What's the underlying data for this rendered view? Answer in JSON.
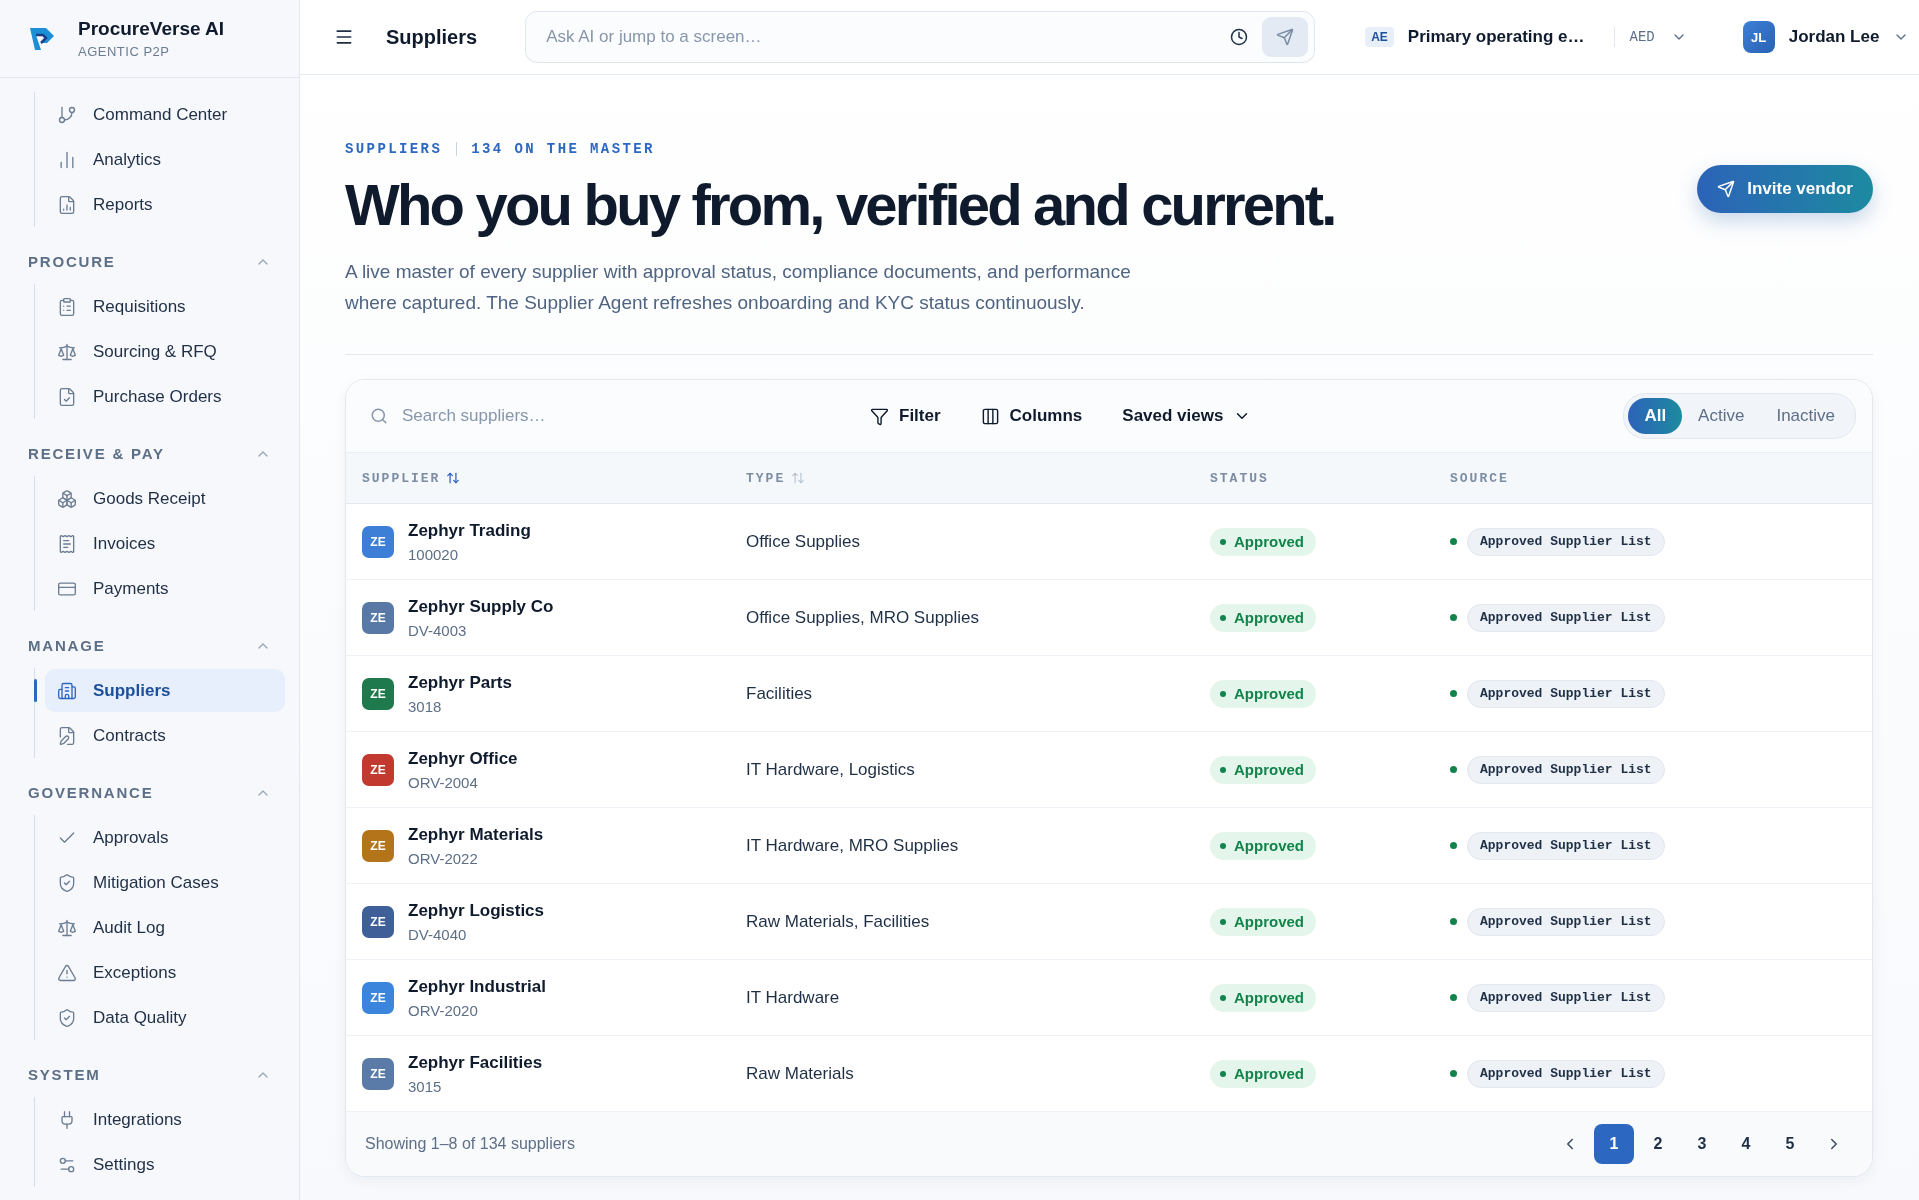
{
  "app": {
    "name": "ProcureVerse AI",
    "tagline": "AGENTIC P2P"
  },
  "sidebar": {
    "top_items": [
      {
        "label": "Command Center",
        "selected": false
      },
      {
        "label": "Analytics",
        "selected": false
      },
      {
        "label": "Reports",
        "selected": false
      }
    ],
    "sections": [
      {
        "title": "PROCURE",
        "expanded": true,
        "items": [
          {
            "label": "Requisitions",
            "selected": false
          },
          {
            "label": "Sourcing & RFQ",
            "selected": false
          },
          {
            "label": "Purchase Orders",
            "selected": false
          }
        ]
      },
      {
        "title": "RECEIVE & PAY",
        "expanded": true,
        "items": [
          {
            "label": "Goods Receipt",
            "selected": false
          },
          {
            "label": "Invoices",
            "selected": false
          },
          {
            "label": "Payments",
            "selected": false
          }
        ]
      },
      {
        "title": "MANAGE",
        "expanded": true,
        "items": [
          {
            "label": "Suppliers",
            "selected": true
          },
          {
            "label": "Contracts",
            "selected": false
          }
        ]
      },
      {
        "title": "GOVERNANCE",
        "expanded": true,
        "items": [
          {
            "label": "Approvals",
            "selected": false
          },
          {
            "label": "Mitigation Cases",
            "selected": false
          },
          {
            "label": "Audit Log",
            "selected": false
          },
          {
            "label": "Exceptions",
            "selected": false
          },
          {
            "label": "Data Quality",
            "selected": false
          }
        ]
      },
      {
        "title": "SYSTEM",
        "expanded": true,
        "items": [
          {
            "label": "Integrations",
            "selected": false
          },
          {
            "label": "Settings",
            "selected": false
          }
        ]
      }
    ]
  },
  "topbar": {
    "page_title": "Suppliers",
    "search": {
      "placeholder": "Ask AI or jump to a screen…"
    },
    "entity": {
      "code": "AE",
      "name": "Primary operating e…",
      "currency": "AED"
    },
    "user": {
      "initials": "JL",
      "name": "Jordan Lee"
    }
  },
  "hero": {
    "eyebrow": "SUPPLIERS",
    "count": "134 ON THE MASTER",
    "title": "Who you buy from, verified and current.",
    "description": "A live master of every supplier with approval status, compliance documents, and performance where captured. The Supplier Agent refreshes onboarding and KYC status continuously.",
    "action": "Invite vendor"
  },
  "table": {
    "search": {
      "placeholder": "Search suppliers…"
    },
    "tools": [
      "Filter",
      "Columns",
      "Saved views"
    ],
    "segments": [
      {
        "label": "All",
        "selected": true
      },
      {
        "label": "Active",
        "selected": false
      },
      {
        "label": "Inactive",
        "selected": false
      }
    ],
    "columns": [
      {
        "label": "SUPPLIER",
        "sorted": true
      },
      {
        "label": "TYPE",
        "sorted": false
      },
      {
        "label": "STATUS"
      },
      {
        "label": "SOURCE"
      }
    ],
    "rows": [
      {
        "initials": "ZE",
        "color": "#3d7fd6",
        "name": "Zephyr Trading",
        "code": "100020",
        "type": "Office Supplies",
        "status": "Approved",
        "source": "Approved Supplier List"
      },
      {
        "initials": "ZE",
        "color": "#5879a6",
        "name": "Zephyr Supply Co",
        "code": "DV-4003",
        "type": "Office Supplies, MRO Supplies",
        "status": "Approved",
        "source": "Approved Supplier List"
      },
      {
        "initials": "ZE",
        "color": "#1e7a4c",
        "name": "Zephyr Parts",
        "code": "3018",
        "type": "Facilities",
        "status": "Approved",
        "source": "Approved Supplier List"
      },
      {
        "initials": "ZE",
        "color": "#c2392f",
        "name": "Zephyr Office",
        "code": "ORV-2004",
        "type": "IT Hardware, Logistics",
        "status": "Approved",
        "source": "Approved Supplier List"
      },
      {
        "initials": "ZE",
        "color": "#b4751a",
        "name": "Zephyr Materials",
        "code": "ORV-2022",
        "type": "IT Hardware, MRO Supplies",
        "status": "Approved",
        "source": "Approved Supplier List"
      },
      {
        "initials": "ZE",
        "color": "#3e5f98",
        "name": "Zephyr Logistics",
        "code": "DV-4040",
        "type": "Raw Materials, Facilities",
        "status": "Approved",
        "source": "Approved Supplier List"
      },
      {
        "initials": "ZE",
        "color": "#3b86dc",
        "name": "Zephyr Industrial",
        "code": "ORV-2020",
        "type": "IT Hardware",
        "status": "Approved",
        "source": "Approved Supplier List"
      },
      {
        "initials": "ZE",
        "color": "#5a7ba8",
        "name": "Zephyr Facilities",
        "code": "3015",
        "type": "Raw Materials",
        "status": "Approved",
        "source": "Approved Supplier List"
      }
    ],
    "footer": "Showing 1–8 of 134 suppliers",
    "pages": [
      {
        "label": "1",
        "selected": true
      },
      {
        "label": "2",
        "selected": false
      },
      {
        "label": "3",
        "selected": false
      },
      {
        "label": "4",
        "selected": false
      },
      {
        "label": "5",
        "selected": false
      }
    ]
  }
}
